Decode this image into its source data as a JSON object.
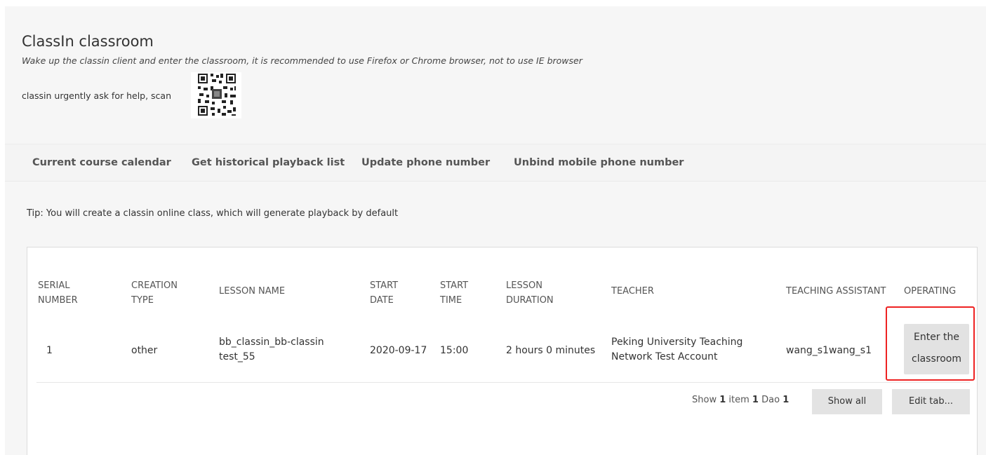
{
  "header": {
    "title": "ClassIn classroom",
    "subtitle": "Wake up the classin client and enter the classroom, it is recommended to use Firefox or Chrome browser, not to use IE browser",
    "help_text": "classin urgently ask for help, scan",
    "qr_icon": "qr-code"
  },
  "nav": {
    "items": [
      {
        "label": "Current course calendar"
      },
      {
        "label": "Get historical playback list"
      },
      {
        "label": "Update phone number"
      },
      {
        "label": "Unbind mobile phone number"
      }
    ]
  },
  "tip": "Tip: You will create a classin online class, which will generate playback by default",
  "table": {
    "headers": {
      "serial": [
        "SERIAL",
        "NUMBER"
      ],
      "creation": [
        "CREATION",
        "TYPE"
      ],
      "lesson_name": "LESSON NAME",
      "start_date": [
        "START",
        "DATE"
      ],
      "start_time": [
        "START",
        "TIME"
      ],
      "duration": [
        "LESSON",
        "DURATION"
      ],
      "teacher": "TEACHER",
      "assistant": "TEACHING ASSISTANT",
      "operating": "OPERATING"
    },
    "rows": [
      {
        "serial": "1",
        "creation": "other",
        "lesson_name": [
          "bb_classin_bb-classin",
          "test_55"
        ],
        "start_date": "2020-09-17",
        "start_time": "15:00",
        "duration": "2 hours 0 minutes",
        "teacher": [
          "Peking University Teaching",
          "Network Test Account"
        ],
        "assistant": "wang_s1wang_s1",
        "action": [
          "Enter the",
          "classroom"
        ]
      }
    ]
  },
  "footer": {
    "pager": {
      "show": "Show",
      "count1": "1",
      "item": "item",
      "count2": "1",
      "dao": "Dao",
      "count3": "1"
    },
    "show_all": "Show all",
    "edit_tab": "Edit tab..."
  },
  "colors": {
    "highlight": "#e22222",
    "panel": "#f6f6f6",
    "button": "#e2e2e2"
  }
}
